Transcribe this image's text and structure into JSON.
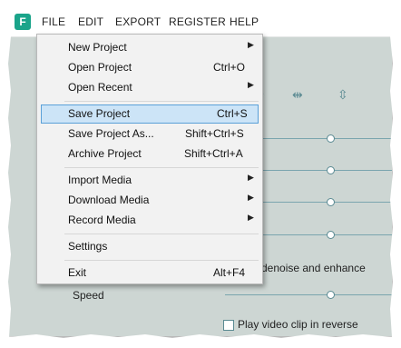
{
  "app": {
    "logo_letter": "F"
  },
  "menubar": [
    "FILE",
    "EDIT",
    "EXPORT",
    "REGISTER",
    "HELP"
  ],
  "file_menu": {
    "items": [
      {
        "label": "New Project",
        "shortcut": "",
        "submenu": true
      },
      {
        "label": "Open Project",
        "shortcut": "Ctrl+O",
        "submenu": false
      },
      {
        "label": "Open Recent",
        "shortcut": "",
        "submenu": true
      },
      {
        "label": "Save Project",
        "shortcut": "Ctrl+S",
        "submenu": false,
        "highlighted": true
      },
      {
        "label": "Save Project As...",
        "shortcut": "Shift+Ctrl+S",
        "submenu": false
      },
      {
        "label": "Archive Project",
        "shortcut": "Shift+Ctrl+A",
        "submenu": false
      },
      {
        "label": "Import Media",
        "shortcut": "",
        "submenu": true
      },
      {
        "label": "Download Media",
        "shortcut": "",
        "submenu": true
      },
      {
        "label": "Record Media",
        "shortcut": "",
        "submenu": true
      },
      {
        "label": "Settings",
        "shortcut": "",
        "submenu": false
      },
      {
        "label": "Exit",
        "shortcut": "Alt+F4",
        "submenu": false
      }
    ]
  },
  "background": {
    "denoise_label": "denoise and enhance",
    "speed_label": "Speed",
    "bottom_label": "Play video clip in reverse"
  },
  "colors": {
    "accent": "#1aa48a",
    "highlight": "#cce4f7",
    "panel_bg": "#cdd6d3"
  }
}
